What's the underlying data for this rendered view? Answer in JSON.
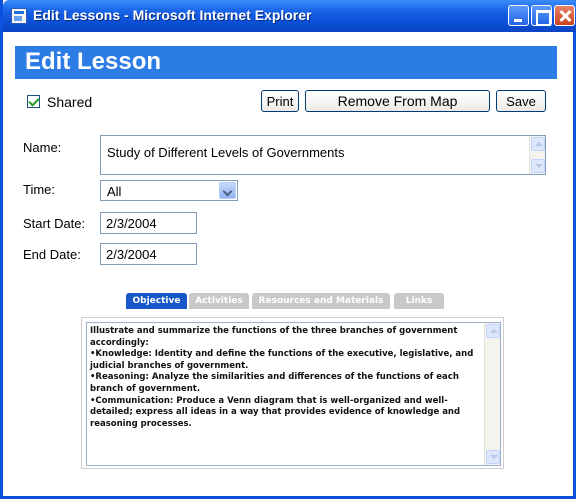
{
  "window": {
    "title": "Edit Lessons - Microsoft Internet Explorer",
    "buttons": [
      "minimize",
      "maximize",
      "close"
    ]
  },
  "page": {
    "heading": "Edit Lesson",
    "header_color": "#2c7ce5"
  },
  "shared": {
    "label": "Shared",
    "checked": true
  },
  "toolbar": {
    "print_label": "Print",
    "remove_label": "Remove From Map",
    "save_label": "Save"
  },
  "form": {
    "name_label": "Name:",
    "name_value": "Study of Different Levels of Governments",
    "time_label": "Time:",
    "time_value": "All",
    "start_label": "Start Date:",
    "start_value": "2/3/2004",
    "end_label": "End Date:",
    "end_value": "2/3/2004"
  },
  "tabs": [
    {
      "label": "Objective",
      "active": true
    },
    {
      "label": "Activities",
      "active": false
    },
    {
      "label": "Resources and Materials",
      "active": false
    },
    {
      "label": "Links",
      "active": false
    }
  ],
  "objective_text": "Illustrate and summarize the functions of the three branches of government accordingly:\n•Knowledge: Identity and define the functions of the executive, legislative, and judicial branches of government.\n•Reasoning: Analyze the similarities and differences of the functions of each branch of government.\n•Communication: Produce a Venn diagram that is well-organized and well-detailed; express all ideas in a way that provides evidence of knowledge and reasoning processes.",
  "colors": {
    "titlebar": "#0b4fd6",
    "active_tab": "#1857c9",
    "inactive_tab": "#c9c9c9"
  }
}
